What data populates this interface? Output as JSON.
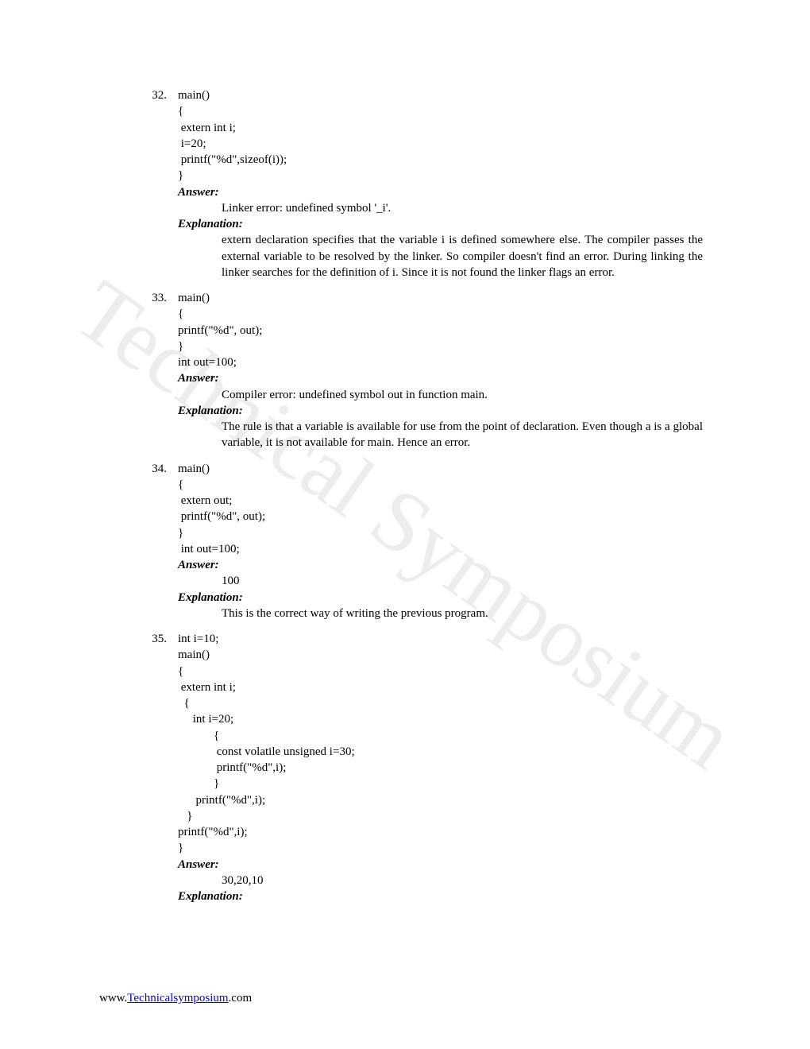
{
  "watermark": "Technical Symposium",
  "questions": [
    {
      "num": "32.",
      "code": "main()\n{\n extern int i;\n i=20;\n printf(\"%d\",sizeof(i));\n}",
      "answer_label": "Answer:",
      "answer": "Linker error: undefined symbol '_i'.",
      "explanation_label": "Explanation:",
      "explanation": "extern declaration specifies that the variable i is defined somewhere else. The compiler passes the external variable to be resolved by the linker. So compiler doesn't find an error. During linking the linker searches for the definition of i. Since it is not found the linker flags an error."
    },
    {
      "num": "33.",
      "code": "main()\n{\nprintf(\"%d\", out);\n}\nint out=100;",
      "answer_label": "Answer:",
      "answer": "Compiler error: undefined symbol out in function main.",
      "explanation_label": "Explanation:",
      "explanation": "The rule is that a variable is available for use from the point of declaration. Even though a is a global variable, it is not available for main. Hence an error."
    },
    {
      "num": "34.",
      "code": "main()\n{\n extern out;\n printf(\"%d\", out);\n}\n int out=100;",
      "answer_label": "Answer:",
      "answer": "100",
      "explanation_label": "Explanation:",
      "explanation": "This is the correct way of writing the previous program."
    },
    {
      "num": "35.",
      "code": "int i=10;\nmain()\n{\n extern int i;\n  {\n     int i=20;\n            {\n             const volatile unsigned i=30;\n             printf(\"%d\",i);\n            }\n      printf(\"%d\",i);\n   }\nprintf(\"%d\",i);\n}",
      "answer_label": "Answer:",
      "answer": "30,20,10",
      "explanation_label": "Explanation:"
    }
  ],
  "footer": {
    "prefix": "www.",
    "link": "Technicalsymposium",
    "suffix": ".com"
  }
}
